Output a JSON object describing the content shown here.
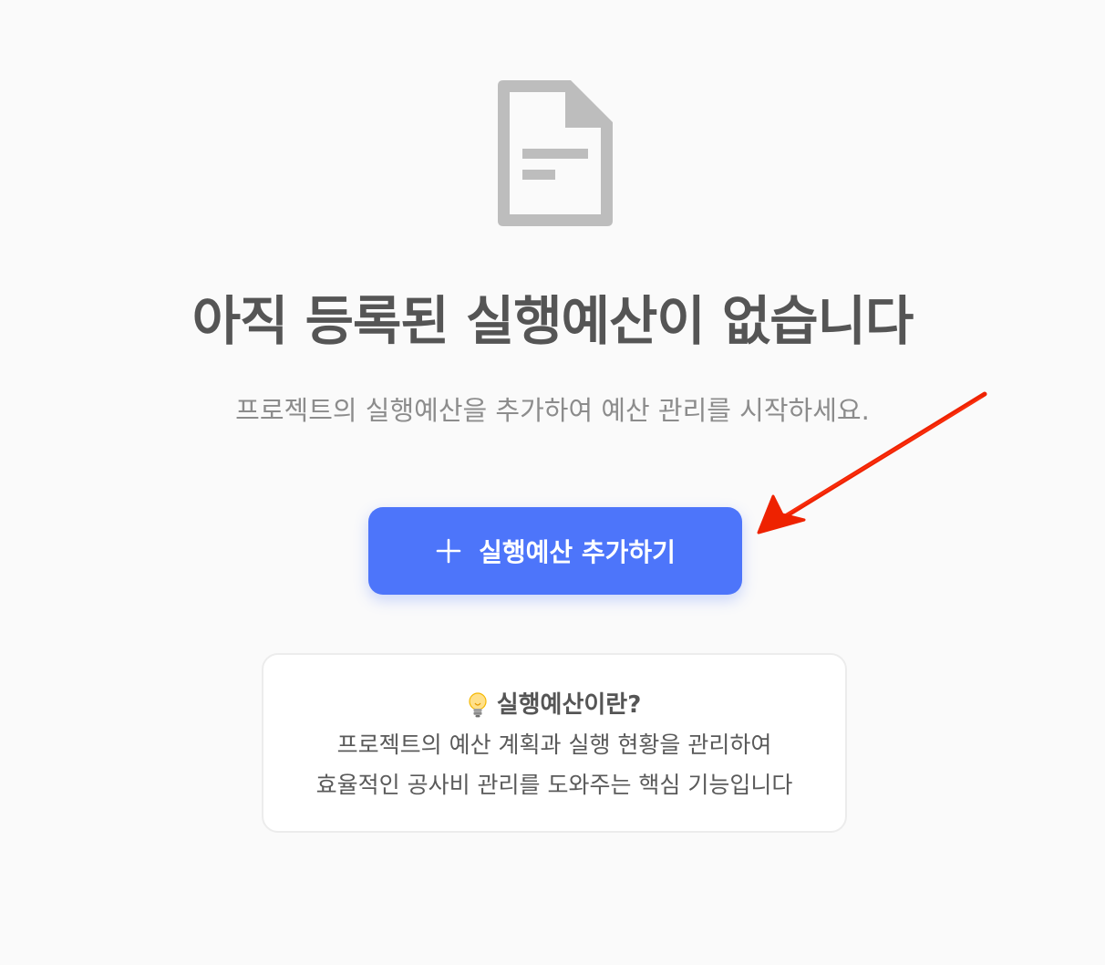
{
  "empty_state": {
    "icon": "document-icon",
    "title": "아직 등록된 실행예산이 없습니다",
    "subtitle": "프로젝트의 실행예산을 추가하여 예산 관리를 시작하세요."
  },
  "add_button": {
    "icon": "plus-icon",
    "label": "실행예산 추가하기",
    "color": "#4d75fa"
  },
  "info_card": {
    "icon": "lightbulb-icon",
    "title": "실행예산이란?",
    "line1": "프로젝트의 예산 계획과 실행 현황을 관리하여",
    "line2": "효율적인 공사비 관리를 도와주는 핵심 기능입니다"
  },
  "annotation": {
    "icon": "arrow-icon",
    "color": "#ee2200"
  },
  "colors": {
    "background": "#fafafa",
    "icon_gray": "#bdbdbd",
    "title_text": "#555555",
    "subtitle_text": "#8c8c8c"
  }
}
